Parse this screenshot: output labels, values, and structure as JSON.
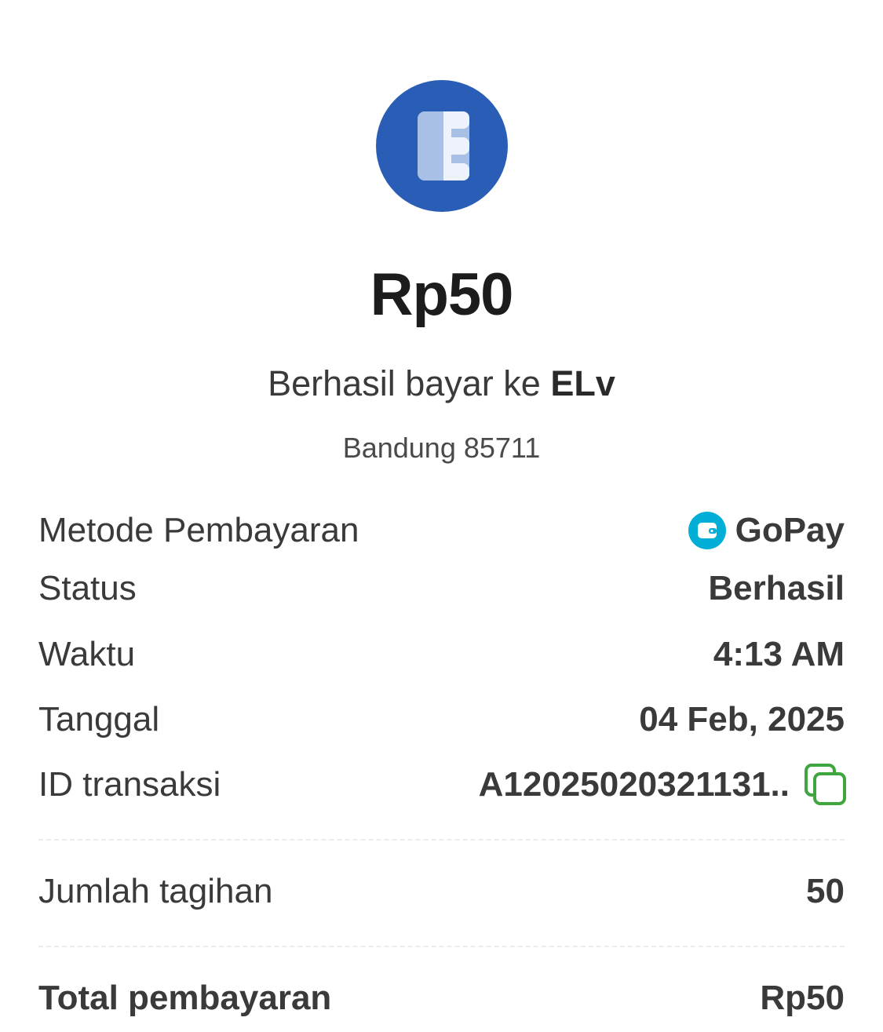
{
  "receipt": {
    "amount": "Rp50",
    "subtitle_prefix": "Berhasil bayar ke",
    "merchant_name": "ELv",
    "location": "Bandung 85711"
  },
  "details": {
    "payment_method_label": "Metode Pembayaran",
    "payment_method_value": "GoPay",
    "status_label": "Status",
    "status_value": "Berhasil",
    "time_label": "Waktu",
    "time_value": "4:13 AM",
    "date_label": "Tanggal",
    "date_value": "04 Feb, 2025",
    "transaction_id_label": "ID transaksi",
    "transaction_id_value": "A120250203211З1..",
    "bill_amount_label": "Jumlah tagihan",
    "bill_amount_value": "50",
    "total_label": "Total pembayaran",
    "total_value": "Rp50"
  },
  "icons": {
    "merchant_logo": "merchant-logo",
    "wallet": "wallet-icon",
    "copy": "copy-icon"
  },
  "colors": {
    "merchant_logo_bg": "#2a5db5",
    "gopay_blue": "#00aed6",
    "copy_green": "#3fa63f"
  }
}
